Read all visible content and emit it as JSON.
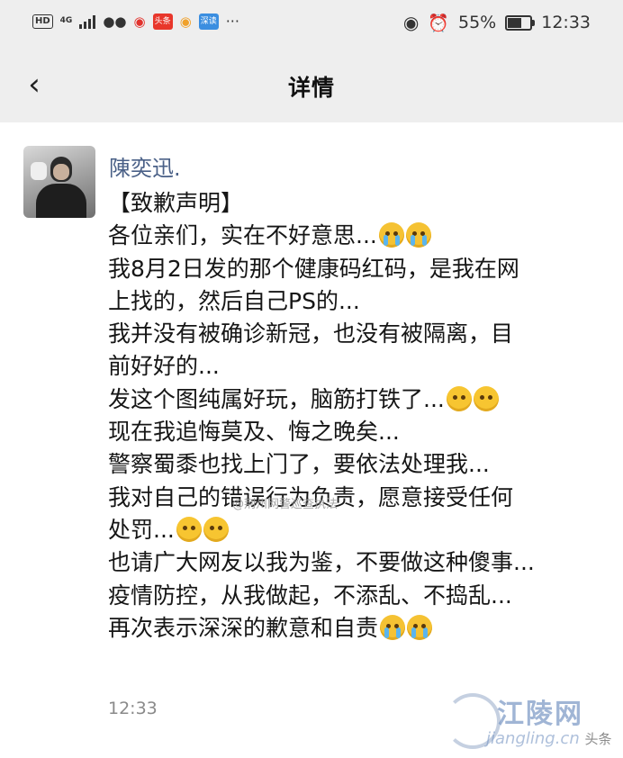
{
  "status_bar": {
    "hd": "HD",
    "network": "4G",
    "badge_news": "头条",
    "badge_app": "深读",
    "more": "···",
    "battery": "55%",
    "time": "12:33",
    "icons": [
      "hd-icon",
      "signal-icon",
      "wechat-icon",
      "weibo-icon",
      "eye-icon",
      "alarm-icon",
      "battery-icon"
    ]
  },
  "nav": {
    "back": "‹",
    "title": "详情"
  },
  "post": {
    "username": "陳奕迅.",
    "lines": [
      "【致歉声明】",
      "各位亲们，实在不好意思...",
      "我8月2日发的那个健康码红码，是我在网",
      "上找的，然后自己PS的...",
      "我并没有被确诊新冠，也没有被隔离，目",
      "前好好的...",
      "发这个图纯属好玩，脑筋打铁了...",
      "现在我追悔莫及、悔之晚矣...",
      "警察蜀黍也找上门了，要依法处理我...",
      "我对自己的错误行为负责，愿意接受任何",
      "处罚...",
      "也请广大网友以我为鉴，不要做这种傻事...",
      "疫情防控，从我做起，不添乱、不捣乱...",
      "再次表示深深的歉意和自责"
    ],
    "watermark": "@荆州网警巡查执法",
    "timestamp": "12:33"
  },
  "logo": {
    "text": "江陵网",
    "sub": "jiangling.cn",
    "overlay": "头条"
  },
  "colors": {
    "bar_bg": "#eeeeee",
    "username": "#4a6087",
    "text": "#161616",
    "timestamp": "#8a8a8a"
  }
}
